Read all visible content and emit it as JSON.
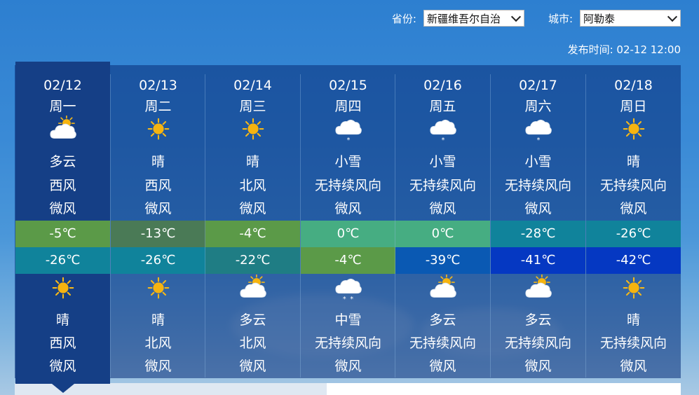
{
  "header": {
    "province_label": "省份:",
    "province_value": "新疆维吾尔自治",
    "city_label": "城市:",
    "city_value": "阿勒泰",
    "publish_label": "发布时间:",
    "publish_time": "02-12 12:00"
  },
  "colors": {
    "warm1": "#5b9a48",
    "warm2": "#4a7a56",
    "zero": "#46ad82",
    "teal": "#10839b",
    "cold1": "#106c95",
    "cold2": "#1f7d84",
    "blue39": "#0a59b3",
    "blue41": "#0538c2",
    "selected": "#153f86"
  },
  "days": [
    {
      "date": "02/12",
      "weekday": "周一",
      "day_icon": "partly-cloudy-icon",
      "day_weather": "多云",
      "day_wind_dir": "西风",
      "day_wind_level": "微风",
      "high": "-5℃",
      "high_color": "#5b9a48",
      "low": "-26℃",
      "low_color": "#10839b",
      "night_icon": "sunny-icon",
      "night_weather": "晴",
      "night_wind_dir": "西风",
      "night_wind_level": "微风"
    },
    {
      "date": "02/13",
      "weekday": "周二",
      "day_icon": "sunny-icon",
      "day_weather": "晴",
      "day_wind_dir": "西风",
      "day_wind_level": "微风",
      "high": "-13℃",
      "high_color": "#4a7a56",
      "low": "-26℃",
      "low_color": "#10839b",
      "night_icon": "sunny-icon",
      "night_weather": "晴",
      "night_wind_dir": "北风",
      "night_wind_level": "微风"
    },
    {
      "date": "02/14",
      "weekday": "周三",
      "day_icon": "sunny-icon",
      "day_weather": "晴",
      "day_wind_dir": "北风",
      "day_wind_level": "微风",
      "high": "-4℃",
      "high_color": "#5b9a48",
      "low": "-22℃",
      "low_color": "#1f7d84",
      "night_icon": "partly-cloudy-icon",
      "night_weather": "多云",
      "night_wind_dir": "北风",
      "night_wind_level": "微风"
    },
    {
      "date": "02/15",
      "weekday": "周四",
      "day_icon": "light-snow-icon",
      "day_weather": "小雪",
      "day_wind_dir": "无持续风向",
      "day_wind_level": "微风",
      "high": "0℃",
      "high_color": "#46ad82",
      "low": "-4℃",
      "low_color": "#5b9a48",
      "night_icon": "moderate-snow-icon",
      "night_weather": "中雪",
      "night_wind_dir": "无持续风向",
      "night_wind_level": "微风"
    },
    {
      "date": "02/16",
      "weekday": "周五",
      "day_icon": "light-snow-icon",
      "day_weather": "小雪",
      "day_wind_dir": "无持续风向",
      "day_wind_level": "微风",
      "high": "0℃",
      "high_color": "#46ad82",
      "low": "-39℃",
      "low_color": "#0a59b3",
      "night_icon": "partly-cloudy-icon",
      "night_weather": "多云",
      "night_wind_dir": "无持续风向",
      "night_wind_level": "微风"
    },
    {
      "date": "02/17",
      "weekday": "周六",
      "day_icon": "light-snow-icon",
      "day_weather": "小雪",
      "day_wind_dir": "无持续风向",
      "day_wind_level": "微风",
      "high": "-28℃",
      "high_color": "#10839b",
      "low": "-41℃",
      "low_color": "#0538c2",
      "night_icon": "partly-cloudy-icon",
      "night_weather": "多云",
      "night_wind_dir": "无持续风向",
      "night_wind_level": "微风"
    },
    {
      "date": "02/18",
      "weekday": "周日",
      "day_icon": "sunny-icon",
      "day_weather": "晴",
      "day_wind_dir": "无持续风向",
      "day_wind_level": "微风",
      "high": "-26℃",
      "high_color": "#10839b",
      "low": "-42℃",
      "low_color": "#0538c2",
      "night_icon": "sunny-icon",
      "night_weather": "晴",
      "night_wind_dir": "无持续风向",
      "night_wind_level": "微风"
    }
  ]
}
